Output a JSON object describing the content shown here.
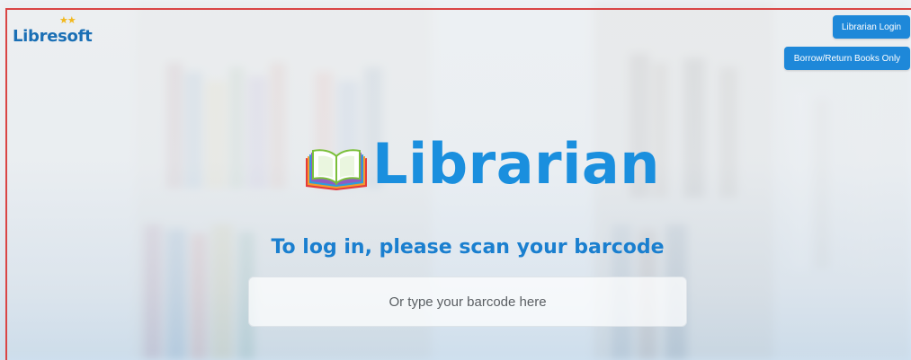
{
  "logo": {
    "text": "Libresoft",
    "stars": "★★"
  },
  "header": {
    "librarian_login_label": "Librarian Login",
    "borrow_return_label": "Borrow/Return Books Only"
  },
  "brand": {
    "title": "Librarian",
    "icon": "open-book-icon"
  },
  "login": {
    "prompt": "To log in, please scan your barcode",
    "barcode_value": "",
    "barcode_placeholder": "Or type your barcode here"
  },
  "colors": {
    "accent": "#1e88d9",
    "title_blue": "#1a8fde",
    "logo_star": "#f2b81c",
    "frame_red": "#d94545"
  }
}
